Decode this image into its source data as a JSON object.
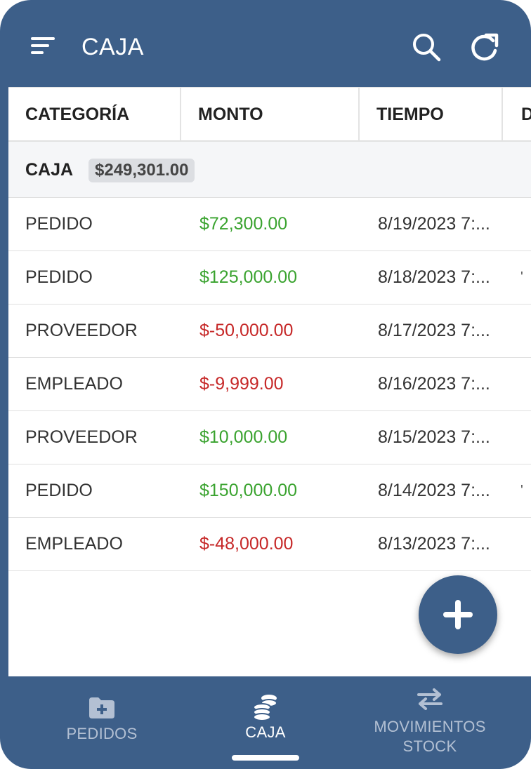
{
  "header": {
    "title": "CAJA"
  },
  "table": {
    "columns": [
      "CATEGORÍA",
      "MONTO",
      "TIEMPO",
      "D"
    ],
    "group": {
      "label": "CAJA",
      "total": "$249,301.00"
    },
    "rows": [
      {
        "category": "PEDIDO",
        "amount": "$72,300.00",
        "sign": "positive",
        "time": "8/19/2023 7:...",
        "extra": ""
      },
      {
        "category": "PEDIDO",
        "amount": "$125,000.00",
        "sign": "positive",
        "time": "8/18/2023 7:...",
        "extra": "'"
      },
      {
        "category": "PROVEEDOR",
        "amount": "$-50,000.00",
        "sign": "negative",
        "time": "8/17/2023 7:...",
        "extra": ""
      },
      {
        "category": "EMPLEADO",
        "amount": "$-9,999.00",
        "sign": "negative",
        "time": "8/16/2023 7:...",
        "extra": ""
      },
      {
        "category": "PROVEEDOR",
        "amount": "$10,000.00",
        "sign": "positive",
        "time": "8/15/2023 7:...",
        "extra": ""
      },
      {
        "category": "PEDIDO",
        "amount": "$150,000.00",
        "sign": "positive",
        "time": "8/14/2023 7:...",
        "extra": "'"
      },
      {
        "category": "EMPLEADO",
        "amount": "$-48,000.00",
        "sign": "negative",
        "time": "8/13/2023 7:...",
        "extra": ""
      }
    ]
  },
  "bottom_nav": {
    "items": [
      {
        "label": "PEDIDOS",
        "icon": "folder-plus-icon",
        "active": false
      },
      {
        "label": "CAJA",
        "icon": "coins-icon",
        "active": true
      },
      {
        "label": "MOVIMIENTOS",
        "label2": "STOCK",
        "icon": "swap-arrows-icon",
        "active": false
      }
    ]
  },
  "colors": {
    "primary": "#3d5f89",
    "positive": "#3aa32f",
    "negative": "#c62828",
    "nav_inactive": "#b3c0d3"
  }
}
